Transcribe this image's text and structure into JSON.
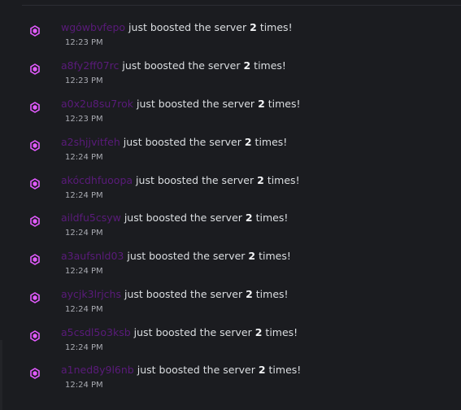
{
  "colors": {
    "background": "#1b1c20",
    "boost_icon": "#e35bff",
    "username": "#5a1b7a",
    "text": "#dbdee1",
    "timestamp": "#a9abb2"
  },
  "icons": {
    "boost": "server-boost-icon"
  },
  "messages": [
    {
      "username": "wgówbvfepo",
      "action_pre": "just boosted the server",
      "count": "2",
      "action_post": "times!",
      "time": "12:23 PM"
    },
    {
      "username": "a8fy2ff07rc",
      "action_pre": "just boosted the server",
      "count": "2",
      "action_post": "times!",
      "time": "12:23 PM"
    },
    {
      "username": "a0x2u8su7rok",
      "action_pre": "just boosted the server",
      "count": "2",
      "action_post": "times!",
      "time": "12:23 PM"
    },
    {
      "username": "a2shjjvitfeh",
      "action_pre": "just boosted the server",
      "count": "2",
      "action_post": "times!",
      "time": "12:24 PM"
    },
    {
      "username": "akócdhfuoopa",
      "action_pre": "just boosted the server",
      "count": "2",
      "action_post": "times!",
      "time": "12:24 PM"
    },
    {
      "username": "aildfu5csyw",
      "action_pre": "just boosted the server",
      "count": "2",
      "action_post": "times!",
      "time": "12:24 PM"
    },
    {
      "username": "a3aufsnld03",
      "action_pre": "just boosted the server",
      "count": "2",
      "action_post": "times!",
      "time": "12:24 PM"
    },
    {
      "username": "aycjk3lrjchs",
      "action_pre": "just boosted the server",
      "count": "2",
      "action_post": "times!",
      "time": "12:24 PM"
    },
    {
      "username": "a5csdl5o3ksb",
      "action_pre": "just boosted the server",
      "count": "2",
      "action_post": "times!",
      "time": "12:24 PM"
    },
    {
      "username": "a1ned8y9l6nb",
      "action_pre": "just boosted the server",
      "count": "2",
      "action_post": "times!",
      "time": "12:24 PM"
    }
  ]
}
